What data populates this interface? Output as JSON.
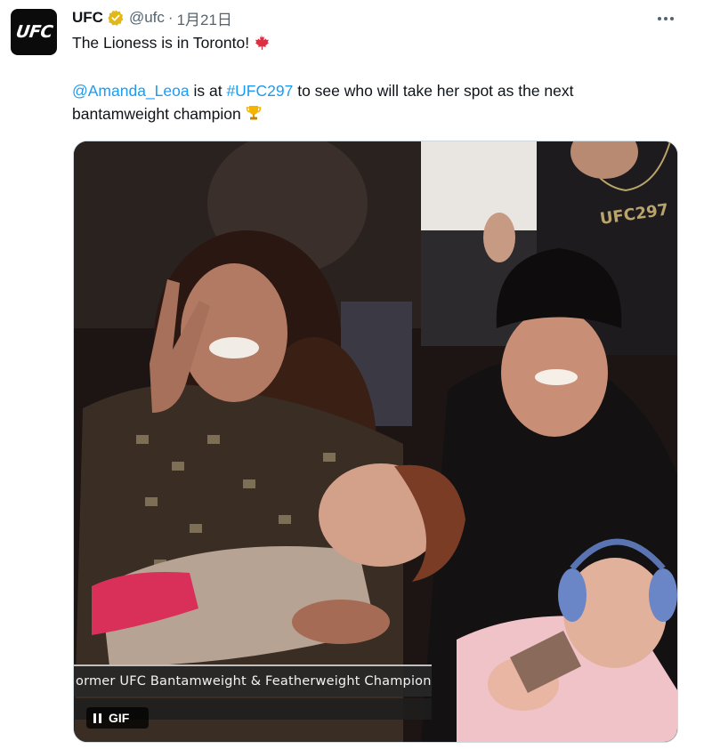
{
  "author": {
    "name": "UFC",
    "handle": "@ufc",
    "separator": "·",
    "date": "1月21日",
    "avatar_text": "UFC",
    "verified_icon": "gold-verified-badge"
  },
  "tweet": {
    "line1": "The Lioness is in Toronto!",
    "line1_emoji": "maple-leaf-emoji",
    "mention": "@Amanda_Leoa",
    "mid_text": " is at ",
    "hashtag": "#UFC297",
    "line2_rest": " to see who will take her spot as the next",
    "line3": "bantamweight champion",
    "line3_emoji": "trophy-emoji"
  },
  "media": {
    "caption": "ormer UFC Bantamweight & Featherweight Champion",
    "badge_label": "GIF",
    "shirt_text": "UFC297"
  },
  "colors": {
    "link": "#1d9bf0",
    "secondary_text": "#536471",
    "verified_gold": "#e2b719"
  }
}
